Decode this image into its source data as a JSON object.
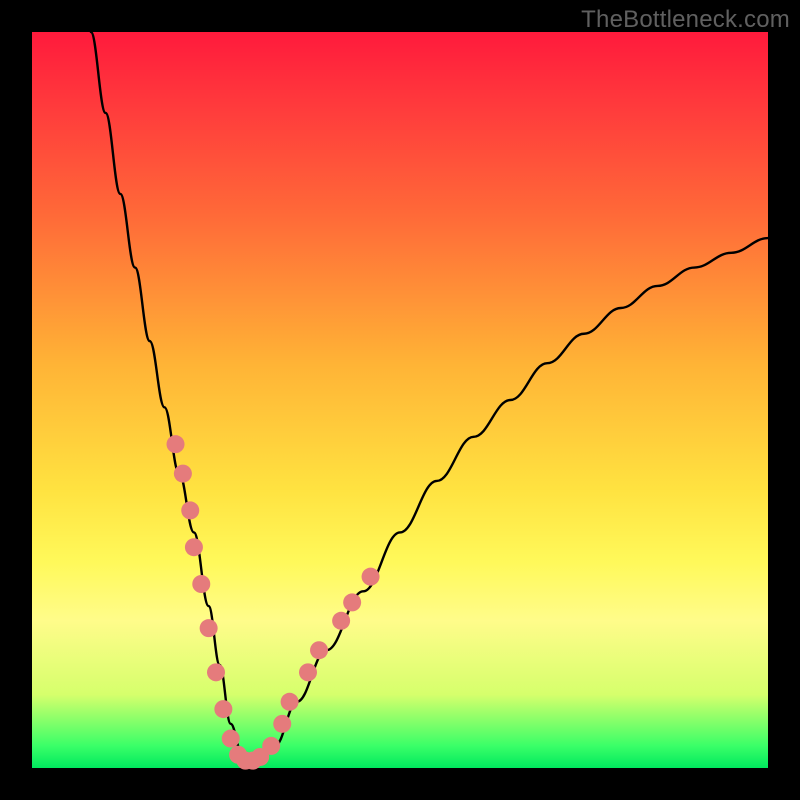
{
  "watermark": "TheBottleneck.com",
  "chart_data": {
    "type": "line",
    "title": "",
    "xlabel": "",
    "ylabel": "",
    "xlim": [
      0,
      100
    ],
    "ylim": [
      0,
      100
    ],
    "series": [
      {
        "name": "curve",
        "color": "#000000",
        "x": [
          8,
          10,
          12,
          14,
          16,
          18,
          20,
          22,
          24,
          25.5,
          27,
          28.5,
          30,
          33,
          36,
          40,
          45,
          50,
          55,
          60,
          65,
          70,
          75,
          80,
          85,
          90,
          95,
          100
        ],
        "y": [
          100,
          89,
          78,
          68,
          58,
          49,
          40,
          32,
          22,
          14,
          6,
          2,
          0,
          3,
          9,
          16,
          24,
          32,
          39,
          45,
          50,
          55,
          59,
          62.5,
          65.5,
          68,
          70,
          72
        ]
      }
    ],
    "markers": {
      "name": "dots",
      "color": "#e57b7c",
      "radius": 9,
      "points": [
        {
          "x": 19.5,
          "y": 44
        },
        {
          "x": 20.5,
          "y": 40
        },
        {
          "x": 21.5,
          "y": 35
        },
        {
          "x": 22.0,
          "y": 30
        },
        {
          "x": 23.0,
          "y": 25
        },
        {
          "x": 24.0,
          "y": 19
        },
        {
          "x": 25.0,
          "y": 13
        },
        {
          "x": 26.0,
          "y": 8
        },
        {
          "x": 27.0,
          "y": 4
        },
        {
          "x": 28.0,
          "y": 1.8
        },
        {
          "x": 29.0,
          "y": 1.0
        },
        {
          "x": 30.0,
          "y": 1.0
        },
        {
          "x": 31.0,
          "y": 1.5
        },
        {
          "x": 32.5,
          "y": 3
        },
        {
          "x": 34.0,
          "y": 6
        },
        {
          "x": 35.0,
          "y": 9
        },
        {
          "x": 37.5,
          "y": 13
        },
        {
          "x": 39.0,
          "y": 16
        },
        {
          "x": 42.0,
          "y": 20
        },
        {
          "x": 43.5,
          "y": 22.5
        },
        {
          "x": 46.0,
          "y": 26
        }
      ]
    },
    "gradient_stops": [
      {
        "pos": 0.0,
        "color": "#ff1a3c"
      },
      {
        "pos": 0.25,
        "color": "#ff6a38"
      },
      {
        "pos": 0.5,
        "color": "#ffc838"
      },
      {
        "pos": 0.72,
        "color": "#fff95a"
      },
      {
        "pos": 0.9,
        "color": "#d6ff6c"
      },
      {
        "pos": 1.0,
        "color": "#00e85e"
      }
    ]
  }
}
